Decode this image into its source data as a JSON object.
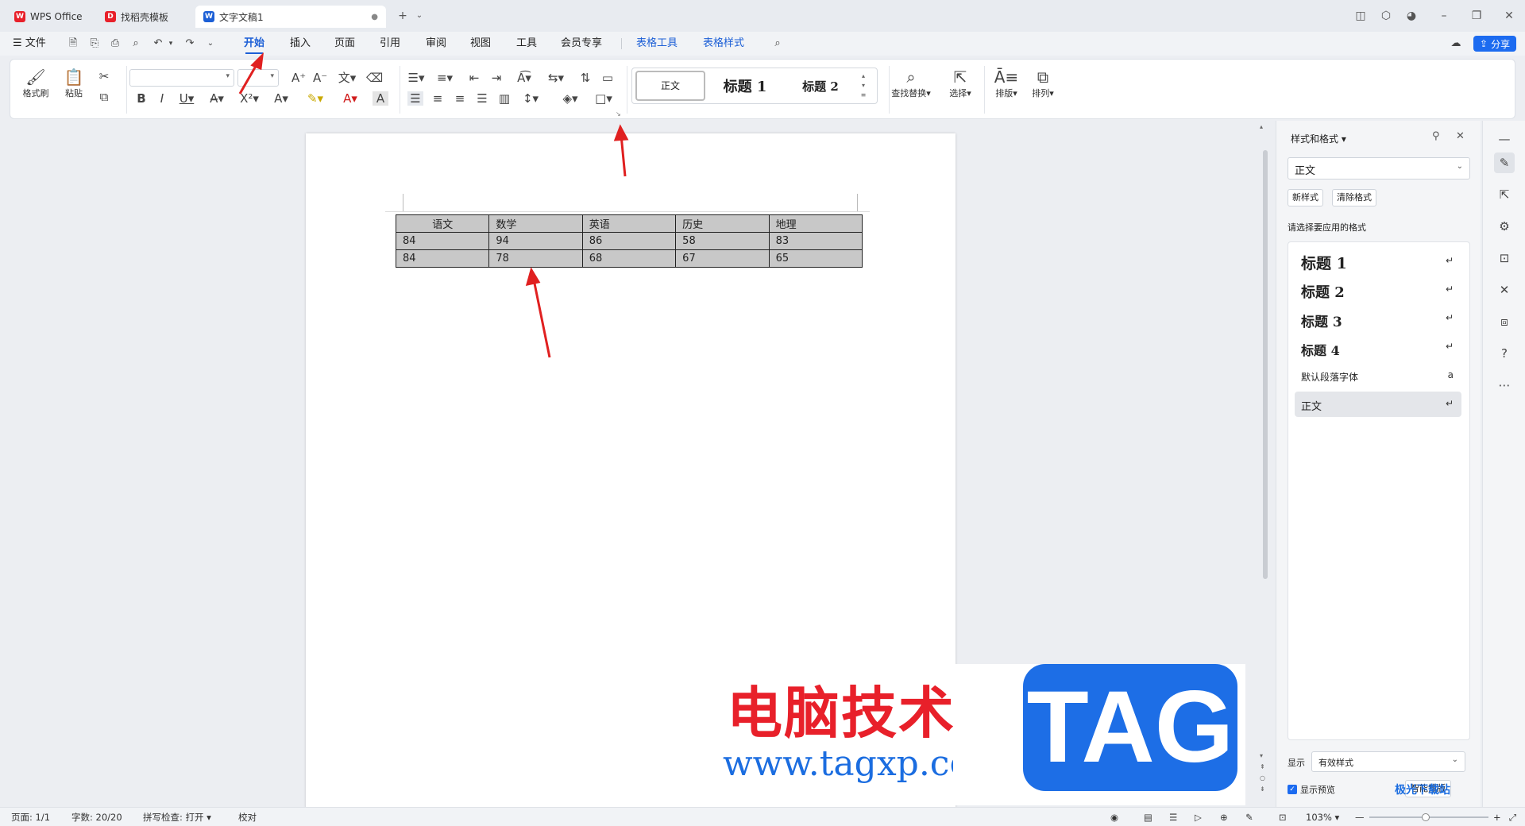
{
  "tabs": [
    {
      "label": "WPS Office",
      "icon": "wps-logo-icon",
      "color": "#e8202a"
    },
    {
      "label": "找稻壳模板",
      "icon": "docer-logo-icon",
      "color": "#e8202a"
    },
    {
      "label": "文字文稿1",
      "icon": "writer-logo-icon",
      "color": "#1c5fd6",
      "active": true
    }
  ],
  "menu": {
    "file": "文件",
    "items": [
      "开始",
      "插入",
      "页面",
      "引用",
      "审阅",
      "视图",
      "工具",
      "会员专享"
    ],
    "active": "开始",
    "tools": [
      "表格工具",
      "表格样式"
    ],
    "share": "分享"
  },
  "ribbon": {
    "format_painter": "格式刷",
    "paste": "粘贴",
    "style_gallery": [
      "正文",
      "标题 1",
      "标题 2"
    ],
    "find_replace": "查找替换",
    "select": "选择",
    "layout": "排版",
    "arrange": "排列"
  },
  "table": {
    "header": [
      "语文",
      "数学",
      "英语",
      "历史",
      "地理"
    ],
    "rows": [
      [
        "84",
        "94",
        "86",
        "58",
        "83"
      ],
      [
        "84",
        "78",
        "68",
        "67",
        "65"
      ]
    ]
  },
  "side_panel": {
    "title": "样式和格式",
    "current_style": "正文",
    "new_style": "新样式",
    "clear_format": "清除格式",
    "prompt": "请选择要应用的格式",
    "styles": [
      {
        "label": "标题 1",
        "mark": "↵"
      },
      {
        "label": "标题 2",
        "mark": "↵"
      },
      {
        "label": "标题 3",
        "mark": "↵"
      },
      {
        "label": "标题 4",
        "mark": "↵"
      },
      {
        "label": "默认段落字体",
        "mark": "a"
      },
      {
        "label": "正文",
        "mark": "↵"
      }
    ],
    "show_label": "显示",
    "show_value": "有效样式",
    "preview_label": "显示预览",
    "smart_layout": "智能排版"
  },
  "status": {
    "page": "页面: 1/1",
    "words": "字数: 20/20",
    "spell": "拼写检查: 打开",
    "proof": "校对",
    "zoom": "103%"
  },
  "watermark": {
    "title": "电脑技术网",
    "url": "www.tagxp.com",
    "tag": "TAG",
    "corner": "极光下载站"
  },
  "annotation_color": "#e02020"
}
